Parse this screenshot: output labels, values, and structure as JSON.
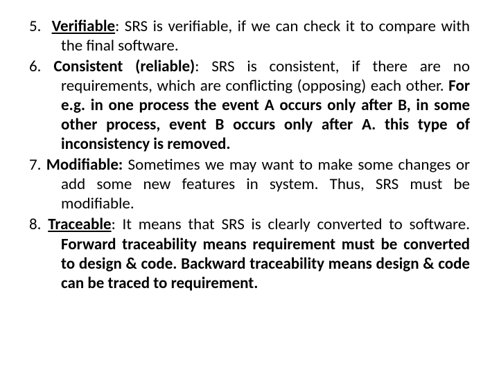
{
  "items": [
    {
      "num": "5.",
      "term": "Verifiable",
      "underline_term": true,
      "colon": ":",
      "body_plain": " SRS is verifiable, if we can check it to compare with the final software.",
      "body_bold": ""
    },
    {
      "num": "6.",
      "term": "Consistent (reliable)",
      "underline_term": false,
      "colon": ":",
      "body_plain": " SRS is consistent, if there are no requirements, which are conflicting (opposing) each other. ",
      "body_bold": "For e.g. in one process the event A occurs only after B, in some other process, event B occurs only after A. this type of inconsistency is removed."
    },
    {
      "num": "7.",
      "term": "Modifiable:",
      "underline_term": false,
      "colon": "",
      "body_plain": " Sometimes we may want to make some changes or add some new features in system. Thus, SRS must be modifiable.",
      "body_bold": ""
    },
    {
      "num": "8.",
      "term": "Traceable",
      "underline_term": true,
      "colon": ":",
      "body_plain": " It means that SRS is clearly converted to software. ",
      "body_bold": "Forward traceability means requirement must be converted to design & code. Backward traceability means design & code can be traced to requirement."
    }
  ]
}
